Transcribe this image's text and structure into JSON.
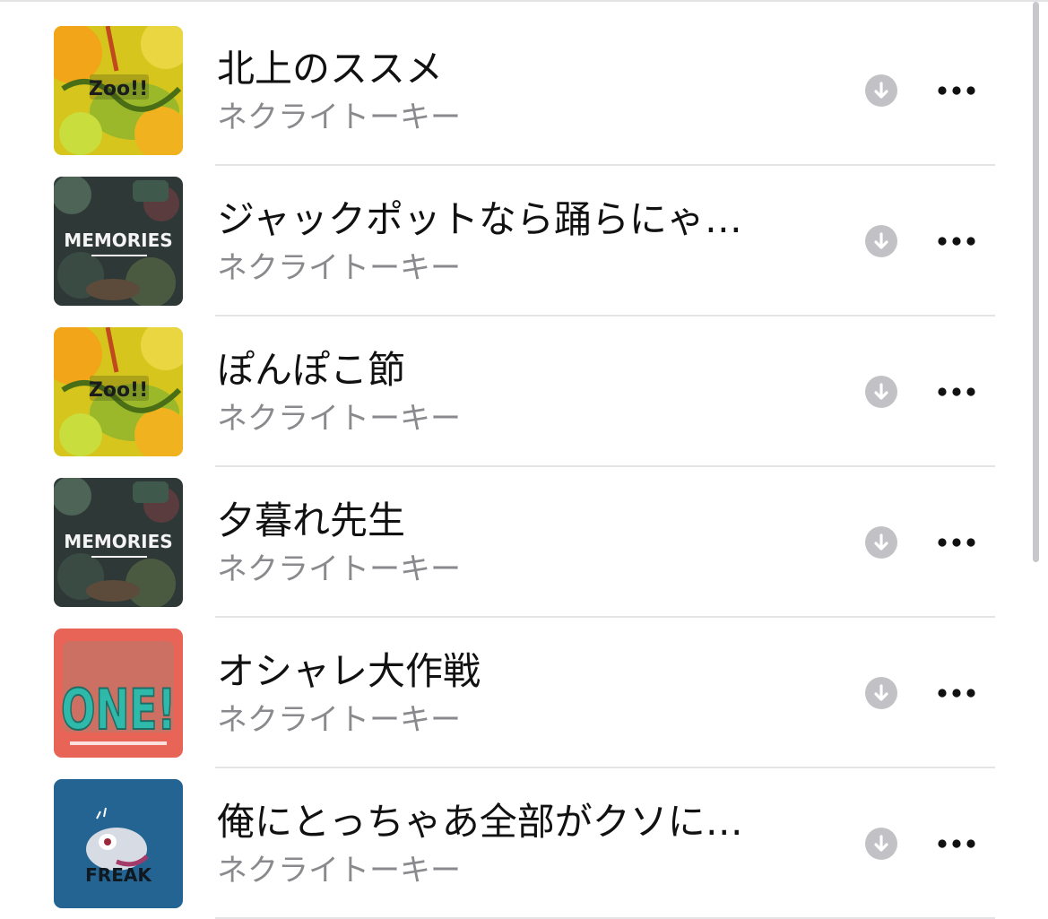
{
  "scroll_position": 0.05,
  "songs": [
    {
      "title": "北上のススメ",
      "artist": "ネクライトーキー",
      "artwork": "zoo-cover-icon",
      "artwork_text": "Zoo!!"
    },
    {
      "title": "ジャックポットなら踊らにゃ…",
      "artist": "ネクライトーキー",
      "artwork": "memories-cover-icon",
      "artwork_text": "MEMORIES"
    },
    {
      "title": "ぽんぽこ節",
      "artist": "ネクライトーキー",
      "artwork": "zoo-cover-icon",
      "artwork_text": "Zoo!!"
    },
    {
      "title": "夕暮れ先生",
      "artist": "ネクライトーキー",
      "artwork": "memories-cover-icon",
      "artwork_text": "MEMORIES"
    },
    {
      "title": "オシャレ大作戦",
      "artist": "ネクライトーキー",
      "artwork": "one-cover-icon",
      "artwork_text": "ONE!"
    },
    {
      "title": "俺にとっちゃあ全部がクソに…",
      "artist": "ネクライトーキー",
      "artwork": "freak-cover-icon",
      "artwork_text": "FREAK"
    }
  ],
  "icons": {
    "download": "download-arrow-icon",
    "more": "more-ellipsis-icon"
  },
  "colors": {
    "title": "#111111",
    "artist": "#8a8a8e",
    "download_circle": "#c1c1c6",
    "separator": "#e4e4e7"
  }
}
